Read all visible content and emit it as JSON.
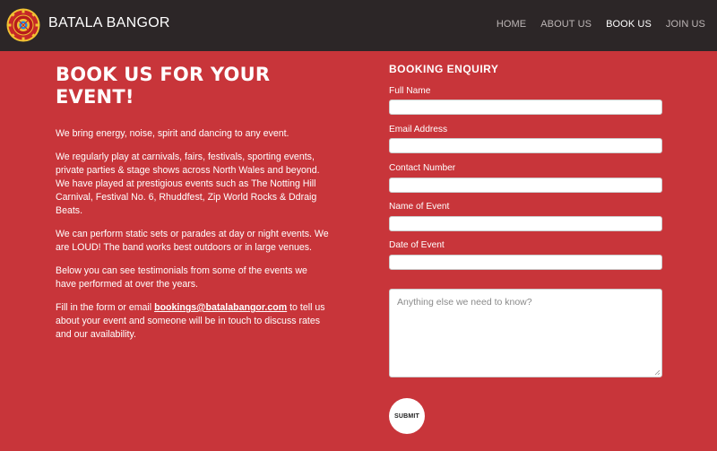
{
  "header": {
    "brand": "BATALA BANGOR",
    "logo_icon": "batala-drum-logo-icon",
    "nav": [
      {
        "label": "HOME",
        "active": false
      },
      {
        "label": "ABOUT US",
        "active": false
      },
      {
        "label": "BOOK US",
        "active": true
      },
      {
        "label": "JOIN US",
        "active": false
      }
    ]
  },
  "main": {
    "title": "BOOK US FOR YOUR EVENT!",
    "paragraphs": [
      "We bring energy, noise, spirit and dancing to any event.",
      "We regularly play at carnivals, fairs, festivals, sporting events, private parties & stage shows across North Wales and beyond. We have played at prestigious events such as The Notting Hill Carnival, Festival No. 6, Rhuddfest, Zip World Rocks & Ddraig Beats.",
      "We can perform static sets or parades at day or night events. We are LOUD! The band works best outdoors or in large venues.",
      "Below you can see testimonials from some of the events we have performed at over the years."
    ],
    "contact": {
      "before": "Fill in the form or email ",
      "email": "bookings@batalabangor.com",
      "after": " to tell us about your event and someone will be in touch to discuss rates and our availability."
    }
  },
  "form": {
    "title": "BOOKING ENQUIRY",
    "fields": [
      {
        "label": "Full Name",
        "value": ""
      },
      {
        "label": "Email Address",
        "value": ""
      },
      {
        "label": "Contact Number",
        "value": ""
      },
      {
        "label": "Name of Event",
        "value": ""
      },
      {
        "label": "Date of Event",
        "value": ""
      }
    ],
    "message_placeholder": "Anything else we need to know?",
    "submit_label": "SUBMIT"
  },
  "colors": {
    "page_background": "#c8353a",
    "header_background": "#2c2627",
    "text": "#ffffff"
  }
}
